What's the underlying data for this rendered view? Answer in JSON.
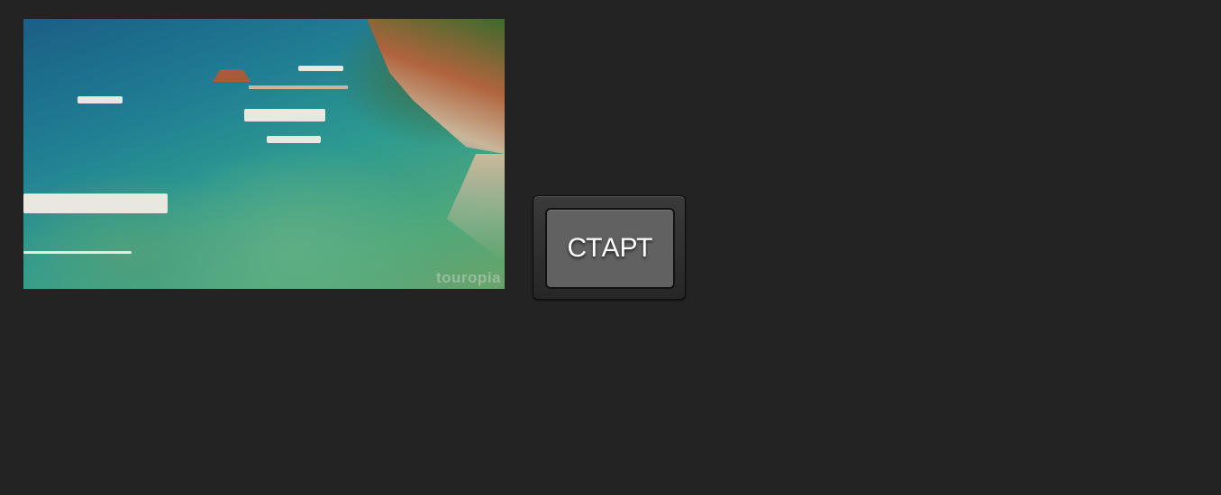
{
  "video": {
    "watermark": "touropia"
  },
  "start_button": {
    "label": "СТАРТ"
  }
}
